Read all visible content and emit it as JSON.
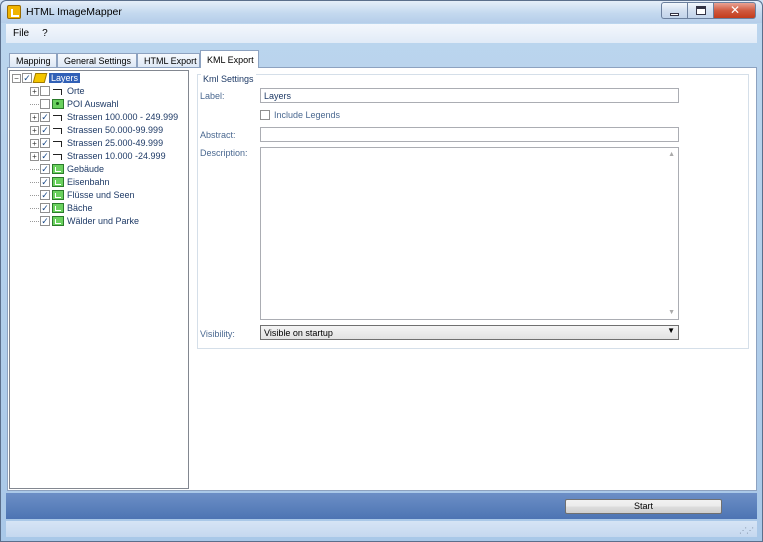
{
  "window": {
    "title": "HTML ImageMapper"
  },
  "menu": [
    "File",
    "?"
  ],
  "tabs": [
    {
      "label": "Mapping",
      "active": false
    },
    {
      "label": "General Settings",
      "active": false
    },
    {
      "label": "HTML Export",
      "active": false
    },
    {
      "label": "KML Export",
      "active": true
    }
  ],
  "tree": {
    "root": {
      "label": "Layers",
      "checked": true,
      "icon": "layers-icon"
    },
    "items": [
      {
        "label": "Orte",
        "checked": false,
        "expandable": true,
        "icon": "line-icon"
      },
      {
        "label": "POI Auswahl",
        "checked": false,
        "expandable": false,
        "icon": "point-icon"
      },
      {
        "label": "Strassen 100.000 - 249.999",
        "checked": true,
        "expandable": true,
        "icon": "line-icon"
      },
      {
        "label": "Strassen 50.000-99.999",
        "checked": true,
        "expandable": true,
        "icon": "line-icon"
      },
      {
        "label": "Strassen 25.000-49.999",
        "checked": true,
        "expandable": true,
        "icon": "line-icon"
      },
      {
        "label": "Strassen 10.000 -24.999",
        "checked": true,
        "expandable": true,
        "icon": "line-icon"
      },
      {
        "label": "Gebäude",
        "checked": true,
        "expandable": false,
        "icon": "polygon-icon"
      },
      {
        "label": "Eisenbahn",
        "checked": true,
        "expandable": false,
        "icon": "polygon-icon"
      },
      {
        "label": "Flüsse und Seen",
        "checked": true,
        "expandable": false,
        "icon": "polygon-icon"
      },
      {
        "label": "Bäche",
        "checked": true,
        "expandable": false,
        "icon": "polygon-icon"
      },
      {
        "label": "Wälder und Parke",
        "checked": true,
        "expandable": false,
        "icon": "polygon-icon"
      }
    ]
  },
  "kml": {
    "group_title": "Kml Settings",
    "label_label": "Label:",
    "label_value": "Layers",
    "include_legends": {
      "label": "Include Legends",
      "checked": false
    },
    "abstract_label": "Abstract:",
    "abstract_value": "",
    "description_label": "Description:",
    "description_value": "",
    "visibility_label": "Visibility:",
    "visibility_value": "Visible on startup"
  },
  "start_button": "Start",
  "colors": {
    "selection": "#3160b6",
    "bottom_strip": "#5a80bd"
  }
}
